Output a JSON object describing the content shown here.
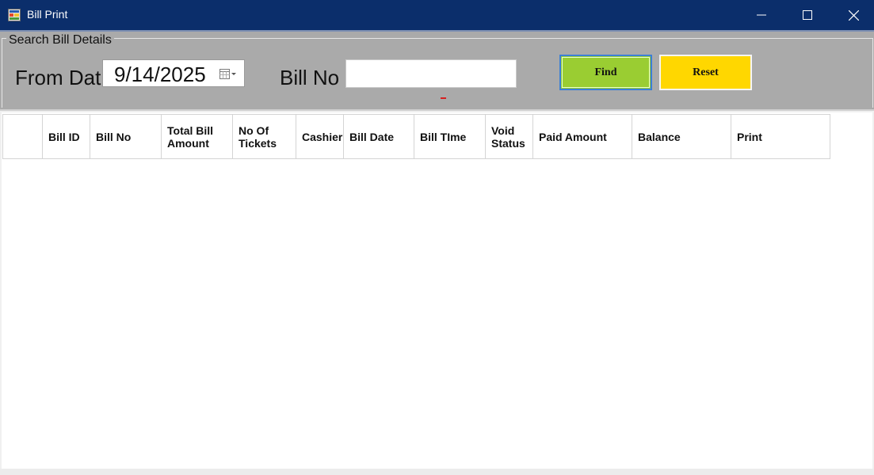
{
  "window": {
    "title": "Bill Print",
    "icon": "app-window-icon",
    "controls": [
      "minimize-icon",
      "maximize-icon",
      "close-icon"
    ]
  },
  "search": {
    "group_title": "Search Bill Details",
    "from_date_label": "From Dat",
    "from_date_value": "9/14/2025",
    "bill_no_label": "Bill No",
    "bill_no_value": "",
    "find_label": "Find",
    "reset_label": "Reset"
  },
  "grid": {
    "columns": [
      "Bill ID",
      "Bill No",
      "Total Bill Amount",
      "No Of Tickets",
      "Cashier",
      "Bill Date",
      "Bill TIme",
      "Void Status",
      "Paid Amount",
      "Balance",
      "Print"
    ],
    "rows": []
  },
  "colors": {
    "titlebar": "#0b2e6b",
    "panel": "#aaaaaa",
    "find_button": "#9acd32",
    "reset_button": "#ffd700"
  }
}
